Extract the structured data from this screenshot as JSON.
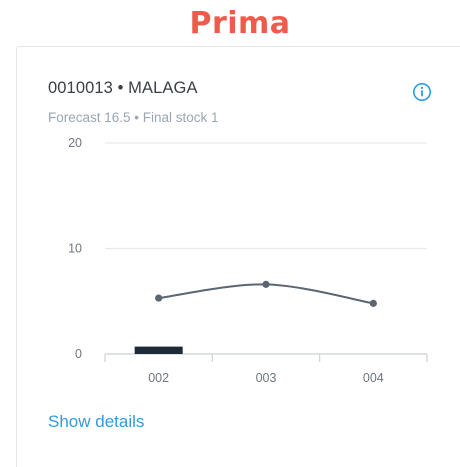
{
  "page": {
    "heading": "Prima"
  },
  "card": {
    "title": "0010013 • MALAGA",
    "subtitle": "Forecast 16.5 • Final stock 1",
    "info_icon": "info-circle-icon",
    "details_label": "Show details"
  },
  "colors": {
    "heading": "#f05a4a",
    "link": "#2d9de0",
    "bar": "#1e2a38",
    "line": "#5b6672",
    "grid": "#e8eaec",
    "muted_text": "#9aa6b3"
  },
  "chart_data": {
    "type": "bar",
    "categories": [
      "002",
      "003",
      "004"
    ],
    "y_ticks": [
      "20",
      "10",
      "0"
    ],
    "ylim": [
      0,
      20
    ],
    "grid": true,
    "series": [
      {
        "kind": "bar",
        "values": [
          0.7,
          0,
          0
        ]
      },
      {
        "kind": "line",
        "values": [
          5.3,
          6.6,
          4.8
        ]
      }
    ],
    "xlabel": "",
    "ylabel": ""
  }
}
